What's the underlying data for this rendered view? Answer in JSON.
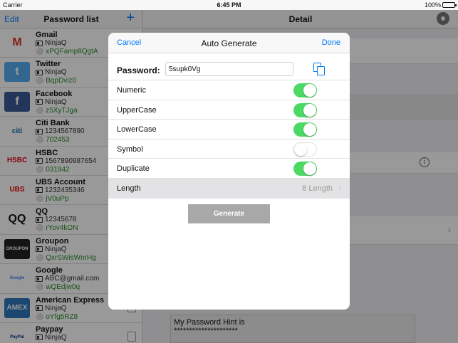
{
  "status_bar": {
    "carrier": "Carrier",
    "time": "6:45 PM",
    "battery": "100%"
  },
  "left_nav": {
    "edit": "Edit",
    "title": "Password list",
    "add": "+"
  },
  "entries": [
    {
      "name": "Gmail",
      "user": "NinjaQ",
      "password": "xPQFamp8QgtA",
      "logo_text": "M",
      "logo_color": "#d93025",
      "logo_bg": "#ffffff"
    },
    {
      "name": "Twitter",
      "user": "NinjaQ",
      "password": "BqpDviz0",
      "logo_text": "t",
      "logo_color": "#ffffff",
      "logo_bg": "#55acee"
    },
    {
      "name": "Facebook",
      "user": "NinjaQ",
      "password": "z5XyTJga",
      "logo_text": "f",
      "logo_color": "#ffffff",
      "logo_bg": "#3b5998"
    },
    {
      "name": "Citi Bank",
      "user": "1234567890",
      "password": "702453",
      "logo_text": "citi",
      "logo_color": "#056dae",
      "logo_bg": "#ffffff"
    },
    {
      "name": "HSBC",
      "user": "1567890987654",
      "password": "031942",
      "logo_text": "HSBC",
      "logo_color": "#db0011",
      "logo_bg": "#ffffff"
    },
    {
      "name": "UBS Account",
      "user": "1232435346",
      "password": "jV0uPp",
      "logo_text": "UBS",
      "logo_color": "#e60000",
      "logo_bg": "#ffffff"
    },
    {
      "name": "QQ",
      "user": "12345678",
      "password": "rYov4kON",
      "logo_text": "QQ",
      "logo_color": "#111111",
      "logo_bg": "#ffffff"
    },
    {
      "name": "Groupon",
      "user": "NinjaQ",
      "password": "QxrSWisWnrHg",
      "logo_text": "GROUPON",
      "logo_color": "#ffffff",
      "logo_bg": "#222222"
    },
    {
      "name": "Google",
      "user": "ABC@gmail.com",
      "password": "wQEdjw0q",
      "logo_text": "Google",
      "logo_color": "#4285f4",
      "logo_bg": "#ffffff"
    },
    {
      "name": "American Express",
      "user": "NinjaQ",
      "password": "oYfg5RZ8",
      "logo_text": "AMEX",
      "logo_color": "#ffffff",
      "logo_bg": "#2e77bb"
    },
    {
      "name": "Paypay",
      "user": "NinjaQ",
      "password": "",
      "logo_text": "PayPal",
      "logo_color": "#003087",
      "logo_bg": "#ffffff"
    }
  ],
  "right_nav": {
    "title": "Detail"
  },
  "hint": {
    "line1": "My Password Hint is",
    "line2": "*********************"
  },
  "modal": {
    "cancel": "Cancel",
    "title": "Auto Generate",
    "done": "Done",
    "password_label": "Password:",
    "password_value": "5supk0Vg",
    "options": [
      {
        "label": "Numeric",
        "on": true
      },
      {
        "label": "UpperCase",
        "on": true
      },
      {
        "label": "LowerCase",
        "on": true
      },
      {
        "label": "Symbol",
        "on": false
      },
      {
        "label": "Duplicate",
        "on": true
      }
    ],
    "length_label": "Length",
    "length_value": "8 Length",
    "generate": "Generate"
  },
  "colors": {
    "accent": "#007aff",
    "toggle_on": "#4cd964",
    "password_text": "#2a8a2a"
  }
}
